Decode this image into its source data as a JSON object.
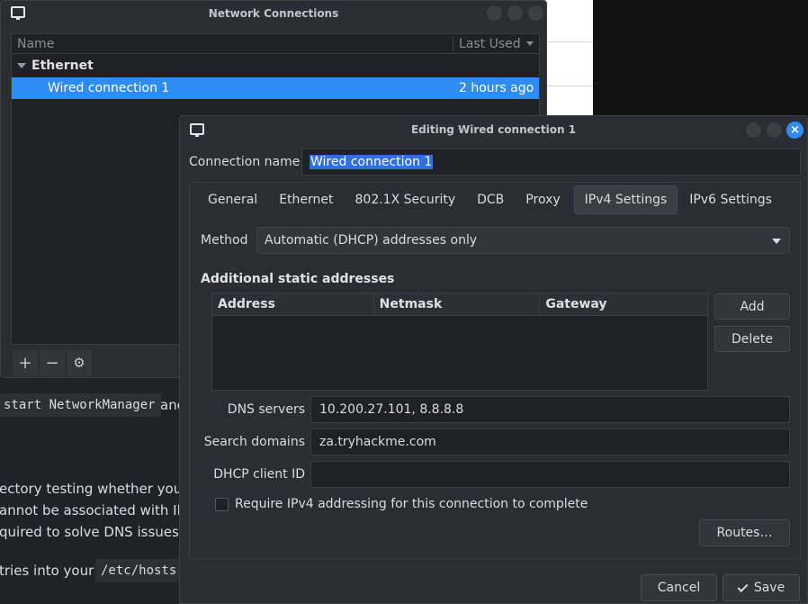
{
  "background": {
    "code_snippet_1": "start NetworkManager",
    "text_after_code": "and",
    "lines": [
      "ectory testing whether you",
      "annot be associated with IPs",
      "quired to solve DNS issues."
    ],
    "last_line_text": "tries into your",
    "code_snippet_2": "/etc/hosts"
  },
  "network_connections": {
    "title": "Network Connections",
    "columns": {
      "name": "Name",
      "last_used": "Last Used"
    },
    "group": "Ethernet",
    "rows": [
      {
        "name": "Wired connection 1",
        "last_used": "2 hours ago"
      }
    ],
    "footer": {
      "add": "+",
      "remove": "−",
      "settings": "⚙"
    }
  },
  "editor": {
    "title": "Editing Wired connection 1",
    "close_glyph": "×",
    "connection_name_label": "Connection name",
    "connection_name_value": "Wired connection 1",
    "tabs": [
      {
        "label": "General"
      },
      {
        "label": "Ethernet"
      },
      {
        "label": "802.1X Security"
      },
      {
        "label": "DCB"
      },
      {
        "label": "Proxy"
      },
      {
        "label": "IPv4 Settings",
        "active": true
      },
      {
        "label": "IPv6 Settings"
      }
    ],
    "method_label": "Method",
    "method_value": "Automatic (DHCP) addresses only",
    "additional_header": "Additional static addresses",
    "address_columns": [
      "Address",
      "Netmask",
      "Gateway"
    ],
    "add_label": "Add",
    "delete_label": "Delete",
    "dns_label": "DNS servers",
    "dns_value": "10.200.27.101, 8.8.8.8",
    "search_label": "Search domains",
    "search_value": "za.tryhackme.com",
    "dhcp_label": "DHCP client ID",
    "dhcp_value": "",
    "require_label": "Require IPv4 addressing for this connection to complete",
    "routes_label": "Routes…",
    "cancel_label": "Cancel",
    "save_label": "Save"
  },
  "colors": {
    "accent": "#2f8cf7",
    "selection": "#2f6fe0",
    "window_bg": "#2a2d33",
    "field_bg": "#1f2126"
  }
}
